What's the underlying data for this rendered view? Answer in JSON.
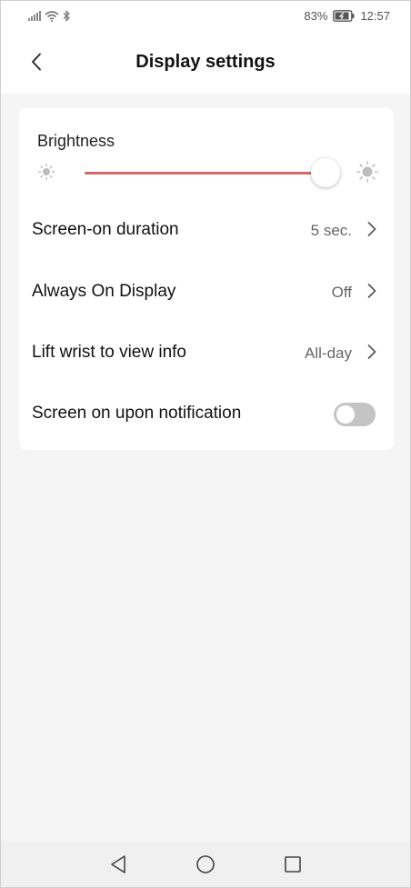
{
  "status_bar": {
    "battery_percent": "83%",
    "time": "12:57"
  },
  "header": {
    "title": "Display settings"
  },
  "brightness": {
    "label": "Brightness",
    "level_fraction": 0.94
  },
  "rows": [
    {
      "label": "Screen-on duration",
      "value": "5 sec."
    },
    {
      "label": "Always On Display",
      "value": "Off"
    },
    {
      "label": "Lift wrist to view info",
      "value": "All-day"
    }
  ],
  "toggle_row": {
    "label": "Screen on upon notification",
    "enabled": false
  },
  "colors": {
    "accent": "#d26a6a",
    "toggle_off": "#c4c4c4",
    "background": "#f5f5f5"
  },
  "icons": {
    "back": "chevron-left-icon",
    "brightness_low": "sun-small-icon",
    "brightness_high": "sun-large-icon",
    "nav_back": "triangle-back-icon",
    "nav_home": "circle-home-icon",
    "nav_recents": "square-recents-icon"
  }
}
